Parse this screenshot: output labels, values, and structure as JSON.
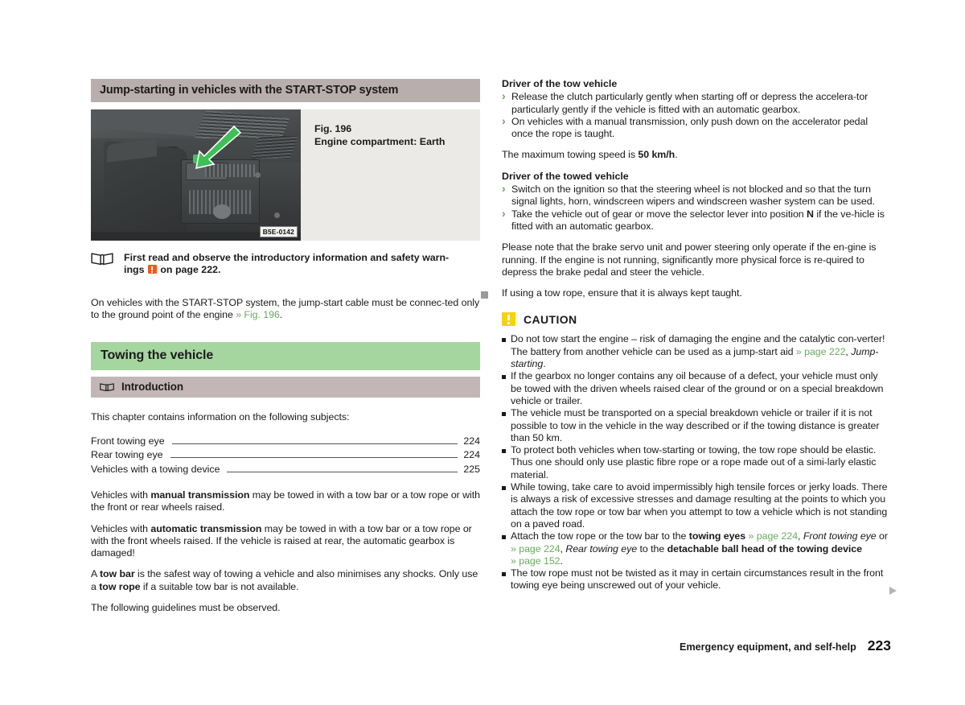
{
  "document": {
    "footer_label": "Emergency equipment, and self-help",
    "footer_page": "223"
  },
  "colors": {
    "chapter_header_bg": "#a6d6a0",
    "section_header_bg": "#b9aeae",
    "subsection_header_bg": "#c3b6b6",
    "xref_green": "#6aab5e",
    "caution_yellow": "#f5d213",
    "warning_orange": "#eb5c1e",
    "figure_panel_bg": "#eceae6"
  },
  "left_column": {
    "section_title": "Jump-starting in vehicles with the START-STOP system",
    "figure": {
      "number": "Fig. 196",
      "caption": "Engine compartment: Earth",
      "image_code": "B5E-0142",
      "alt": "Photo of an engine compartment with a green arrow pointing to the earth/ground point next to the battery"
    },
    "info_note": {
      "icon": "book-icon",
      "text_before": "First read and observe the introductory information and safety warn-",
      "text_line2_a": "ings ",
      "inline_icon": "warning-orange-icon",
      "text_line2_b": " on page 222."
    },
    "paragraph_1": {
      "a": "On vehicles with the START-STOP system, the jump-start cable must be connec-ted only to the ground point of the engine ",
      "xref": "» Fig. 196",
      "b": "."
    },
    "chapter_title": "Towing the vehicle",
    "subsection_title": "Introduction",
    "intro_lead": "This chapter contains information on the following subjects:",
    "toc": [
      {
        "label": "Front towing eye",
        "page": "224"
      },
      {
        "label": "Rear towing eye",
        "page": "224"
      },
      {
        "label": "Vehicles with a towing device",
        "page": "225"
      }
    ],
    "paragraphs": [
      {
        "parts": [
          {
            "t": "Vehicles with ",
            "s": "n"
          },
          {
            "t": "manual transmission",
            "s": "b"
          },
          {
            "t": " may be towed in with a tow bar or a tow rope or with the front or rear wheels raised.",
            "s": "n"
          }
        ]
      },
      {
        "parts": [
          {
            "t": "Vehicles with ",
            "s": "n"
          },
          {
            "t": "automatic transmission",
            "s": "b"
          },
          {
            "t": " may be towed in with a tow bar or a tow rope or with the front wheels raised. If the vehicle is raised at rear, the automatic gearbox is damaged!",
            "s": "n"
          }
        ]
      },
      {
        "parts": [
          {
            "t": "A ",
            "s": "n"
          },
          {
            "t": "tow bar",
            "s": "b"
          },
          {
            "t": " is the safest way of towing a vehicle and also minimises any shocks. Only use a ",
            "s": "n"
          },
          {
            "t": "tow rope",
            "s": "b"
          },
          {
            "t": " if a suitable tow bar is not available.",
            "s": "n"
          }
        ]
      },
      {
        "parts": [
          {
            "t": "The following guidelines must be observed.",
            "s": "n"
          }
        ]
      }
    ]
  },
  "right_column": {
    "head_tow_vehicle": "Driver of the tow vehicle",
    "bullets_tow_vehicle": [
      "Release the clutch particularly gently when starting off or depress the accelera-tor particularly gently if the vehicle is fitted with an automatic gearbox.",
      "On vehicles with a manual transmission, only push down on the accelerator pedal once the rope is taught."
    ],
    "max_speed": {
      "a": "The maximum towing speed is ",
      "b": "50 km/h",
      "c": "."
    },
    "head_towed_vehicle": "Driver of the towed vehicle",
    "bullets_towed_vehicle": [
      {
        "parts": [
          {
            "t": "Switch on the ignition so that the steering wheel is not blocked and so that the turn signal lights, horn, windscreen wipers and windscreen washer system can be used.",
            "s": "n"
          }
        ]
      },
      {
        "parts": [
          {
            "t": "Take the vehicle out of gear or move the selector lever into position ",
            "s": "n"
          },
          {
            "t": "N",
            "s": "b"
          },
          {
            "t": " if the ve-hicle is fitted with an automatic gearbox.",
            "s": "n"
          }
        ]
      }
    ],
    "paragraph_brake_servo": "Please note that the brake servo unit and power steering only operate if the en-gine is running. If the engine is not running, significantly more physical force is re-quired to depress the brake pedal and steer the vehicle.",
    "paragraph_tow_rope": "If using a tow rope, ensure that it is always kept taught.",
    "caution": {
      "title": "CAUTION",
      "items": [
        {
          "parts": [
            {
              "t": "Do not tow start the engine – risk of damaging the engine and the catalytic con-verter! The battery from another vehicle can be used as a jump-start aid ",
              "s": "n"
            },
            {
              "t": "» page 222",
              "s": "x"
            },
            {
              "t": ", ",
              "s": "n"
            },
            {
              "t": "Jump-starting",
              "s": "i"
            },
            {
              "t": ".",
              "s": "n"
            }
          ]
        },
        {
          "parts": [
            {
              "t": "If the gearbox no longer contains any oil because of a defect, your vehicle must only be towed with the driven wheels raised clear of the ground or on a special breakdown vehicle or trailer.",
              "s": "n"
            }
          ]
        },
        {
          "parts": [
            {
              "t": "The vehicle must be transported on a special breakdown vehicle or trailer if it is not possible to tow in the vehicle in the way described or if the towing distance is greater than 50 km.",
              "s": "n"
            }
          ]
        },
        {
          "parts": [
            {
              "t": "To protect both vehicles when tow-starting or towing, the tow rope should be elastic. Thus one should only use plastic fibre rope or a rope made out of a simi-larly elastic material.",
              "s": "n"
            }
          ]
        },
        {
          "parts": [
            {
              "t": "While towing, take care to avoid impermissibly high tensile forces or jerky loads. There is always a risk of excessive stresses and damage resulting at the points to which you attach the tow rope or tow bar when you attempt to tow a vehicle which is not standing on a paved road.",
              "s": "n"
            }
          ]
        },
        {
          "parts": [
            {
              "t": "Attach the tow rope or the tow bar to the ",
              "s": "n"
            },
            {
              "t": "towing eyes",
              "s": "b"
            },
            {
              "t": " ",
              "s": "n"
            },
            {
              "t": "» page 224",
              "s": "x"
            },
            {
              "t": ", ",
              "s": "n"
            },
            {
              "t": "Front towing eye",
              "s": "i"
            },
            {
              "t": " or ",
              "s": "n"
            },
            {
              "t": "» page 224",
              "s": "x"
            },
            {
              "t": ", ",
              "s": "n"
            },
            {
              "t": "Rear towing eye",
              "s": "i"
            },
            {
              "t": " to the ",
              "s": "n"
            },
            {
              "t": "detachable ball head of the towing device",
              "s": "b"
            },
            {
              "t": " ",
              "s": "n"
            },
            {
              "t": "» page 152",
              "s": "x"
            },
            {
              "t": ".",
              "s": "n"
            }
          ]
        },
        {
          "parts": [
            {
              "t": "The tow rope must not be twisted as it may in certain circumstances result in the front towing eye being unscrewed out of your vehicle.",
              "s": "n"
            }
          ]
        }
      ]
    }
  }
}
